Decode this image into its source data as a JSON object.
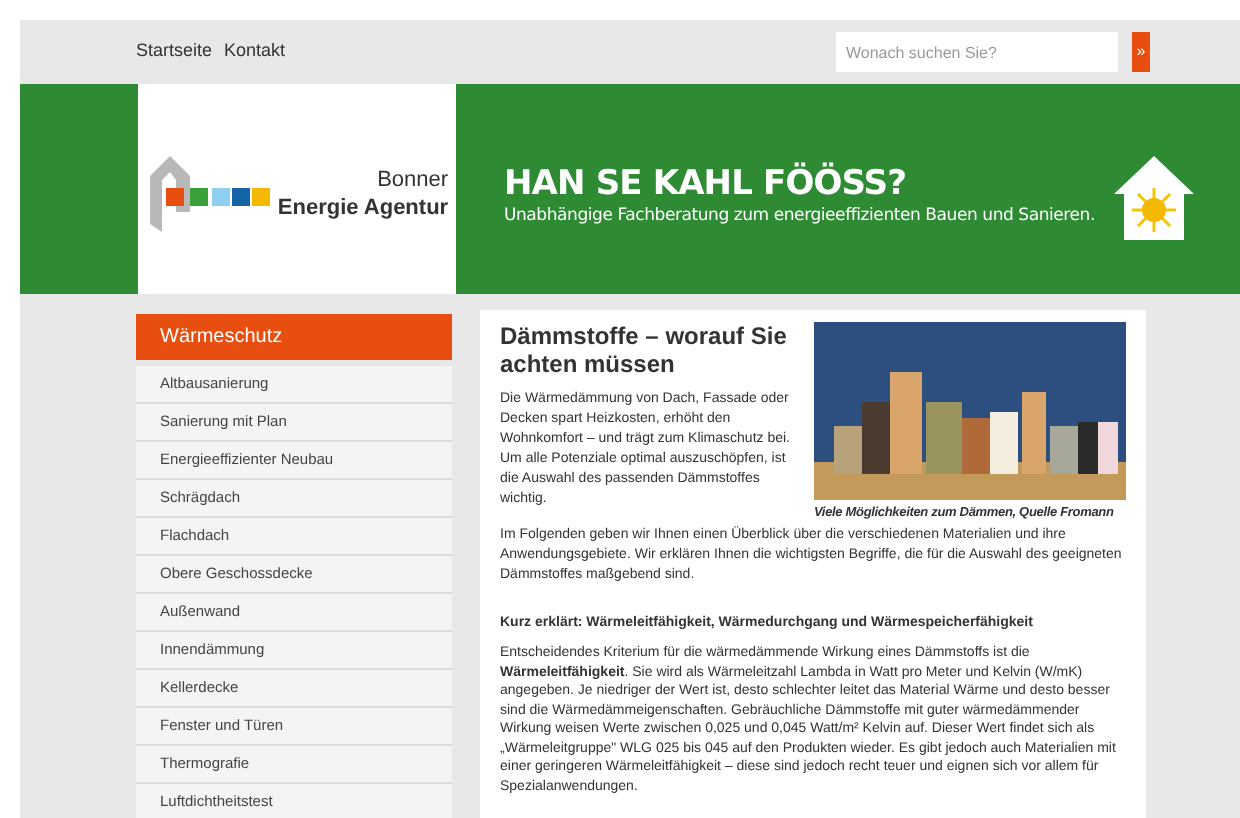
{
  "top_nav": {
    "links": [
      "Startseite",
      "Kontakt"
    ],
    "search": {
      "placeholder": "Wonach suchen Sie?",
      "button": "»"
    }
  },
  "header": {
    "logo": {
      "line1": "Bonner",
      "line2": "Energie Agentur"
    },
    "title": "HAN SE KAHL FÖÖSS?",
    "subtitle": "Unabhängige Fachberatung zum energieeffizienten Bauen und Sanieren."
  },
  "sidebar": {
    "heading": "Wärmeschutz",
    "items": [
      "Altbausanierung",
      "Sanierung mit Plan",
      "Energieeffizienter Neubau",
      "Schrägdach",
      "Flachdach",
      "Obere Geschossdecke",
      "Außenwand",
      "Innendämmung",
      "Kellerdecke",
      "Fenster und Türen",
      "Thermografie",
      "Luftdichtheitstest"
    ]
  },
  "article": {
    "title": "Dämmstoffe – worauf Sie achten müssen",
    "image_caption": "Viele Möglichkeiten zum Dämmen, Quelle Fromann",
    "intro": [
      "Die  Wärmedämmung von Dach, Fassade oder Decken spart Heizkosten, erhöht den Wohnkomfort – und trägt zum Klimaschutz bei. Um alle Potenziale optimal auszuschöpfen, ist die Auswahl des passenden Dämmstoffes wichtig.",
      "Im Folgenden geben wir Ihnen einen Überblick über die verschiedenen Materialien und ihre Anwendungsgebiete. Wir erklären Ihnen die wichtigsten Begriffe, die für die Auswahl des geeigneten Dämmstoffes maßgebend sind."
    ],
    "subheading": "Kurz erklärt: Wärmeleitfähigkeit, Wärmedurchgang und Wärmespeicherfähigkeit",
    "body": "Entscheidendes Kriterium für die wärmedämmende Wirkung eines Dämmstoffs ist die **Wärmeleitfähigkeit**. Sie wird als Wärmeleitzahl Lambda in Watt pro Meter und Kelvin (W/mK) angegeben. Je niedriger der Wert ist, desto schlechter leitet das Material Wärme und desto besser sind die Wärmedämmeigenschaften. Gebräuchliche Dämmstoffe mit guter wärmedämmender Wirkung weisen Werte zwischen 0,025 und 0,045 Watt/m² Kelvin auf. Dieser Wert findet sich als „Wärmeleitgruppe\" WLG 025 bis 045 auf den Produkten wieder. Es gibt jedoch auch Materialien mit einer geringeren Wärmeleitfähigkeit – diese sind jedoch recht teuer und eignen sich vor allem für Spezialanwendungen."
  }
}
